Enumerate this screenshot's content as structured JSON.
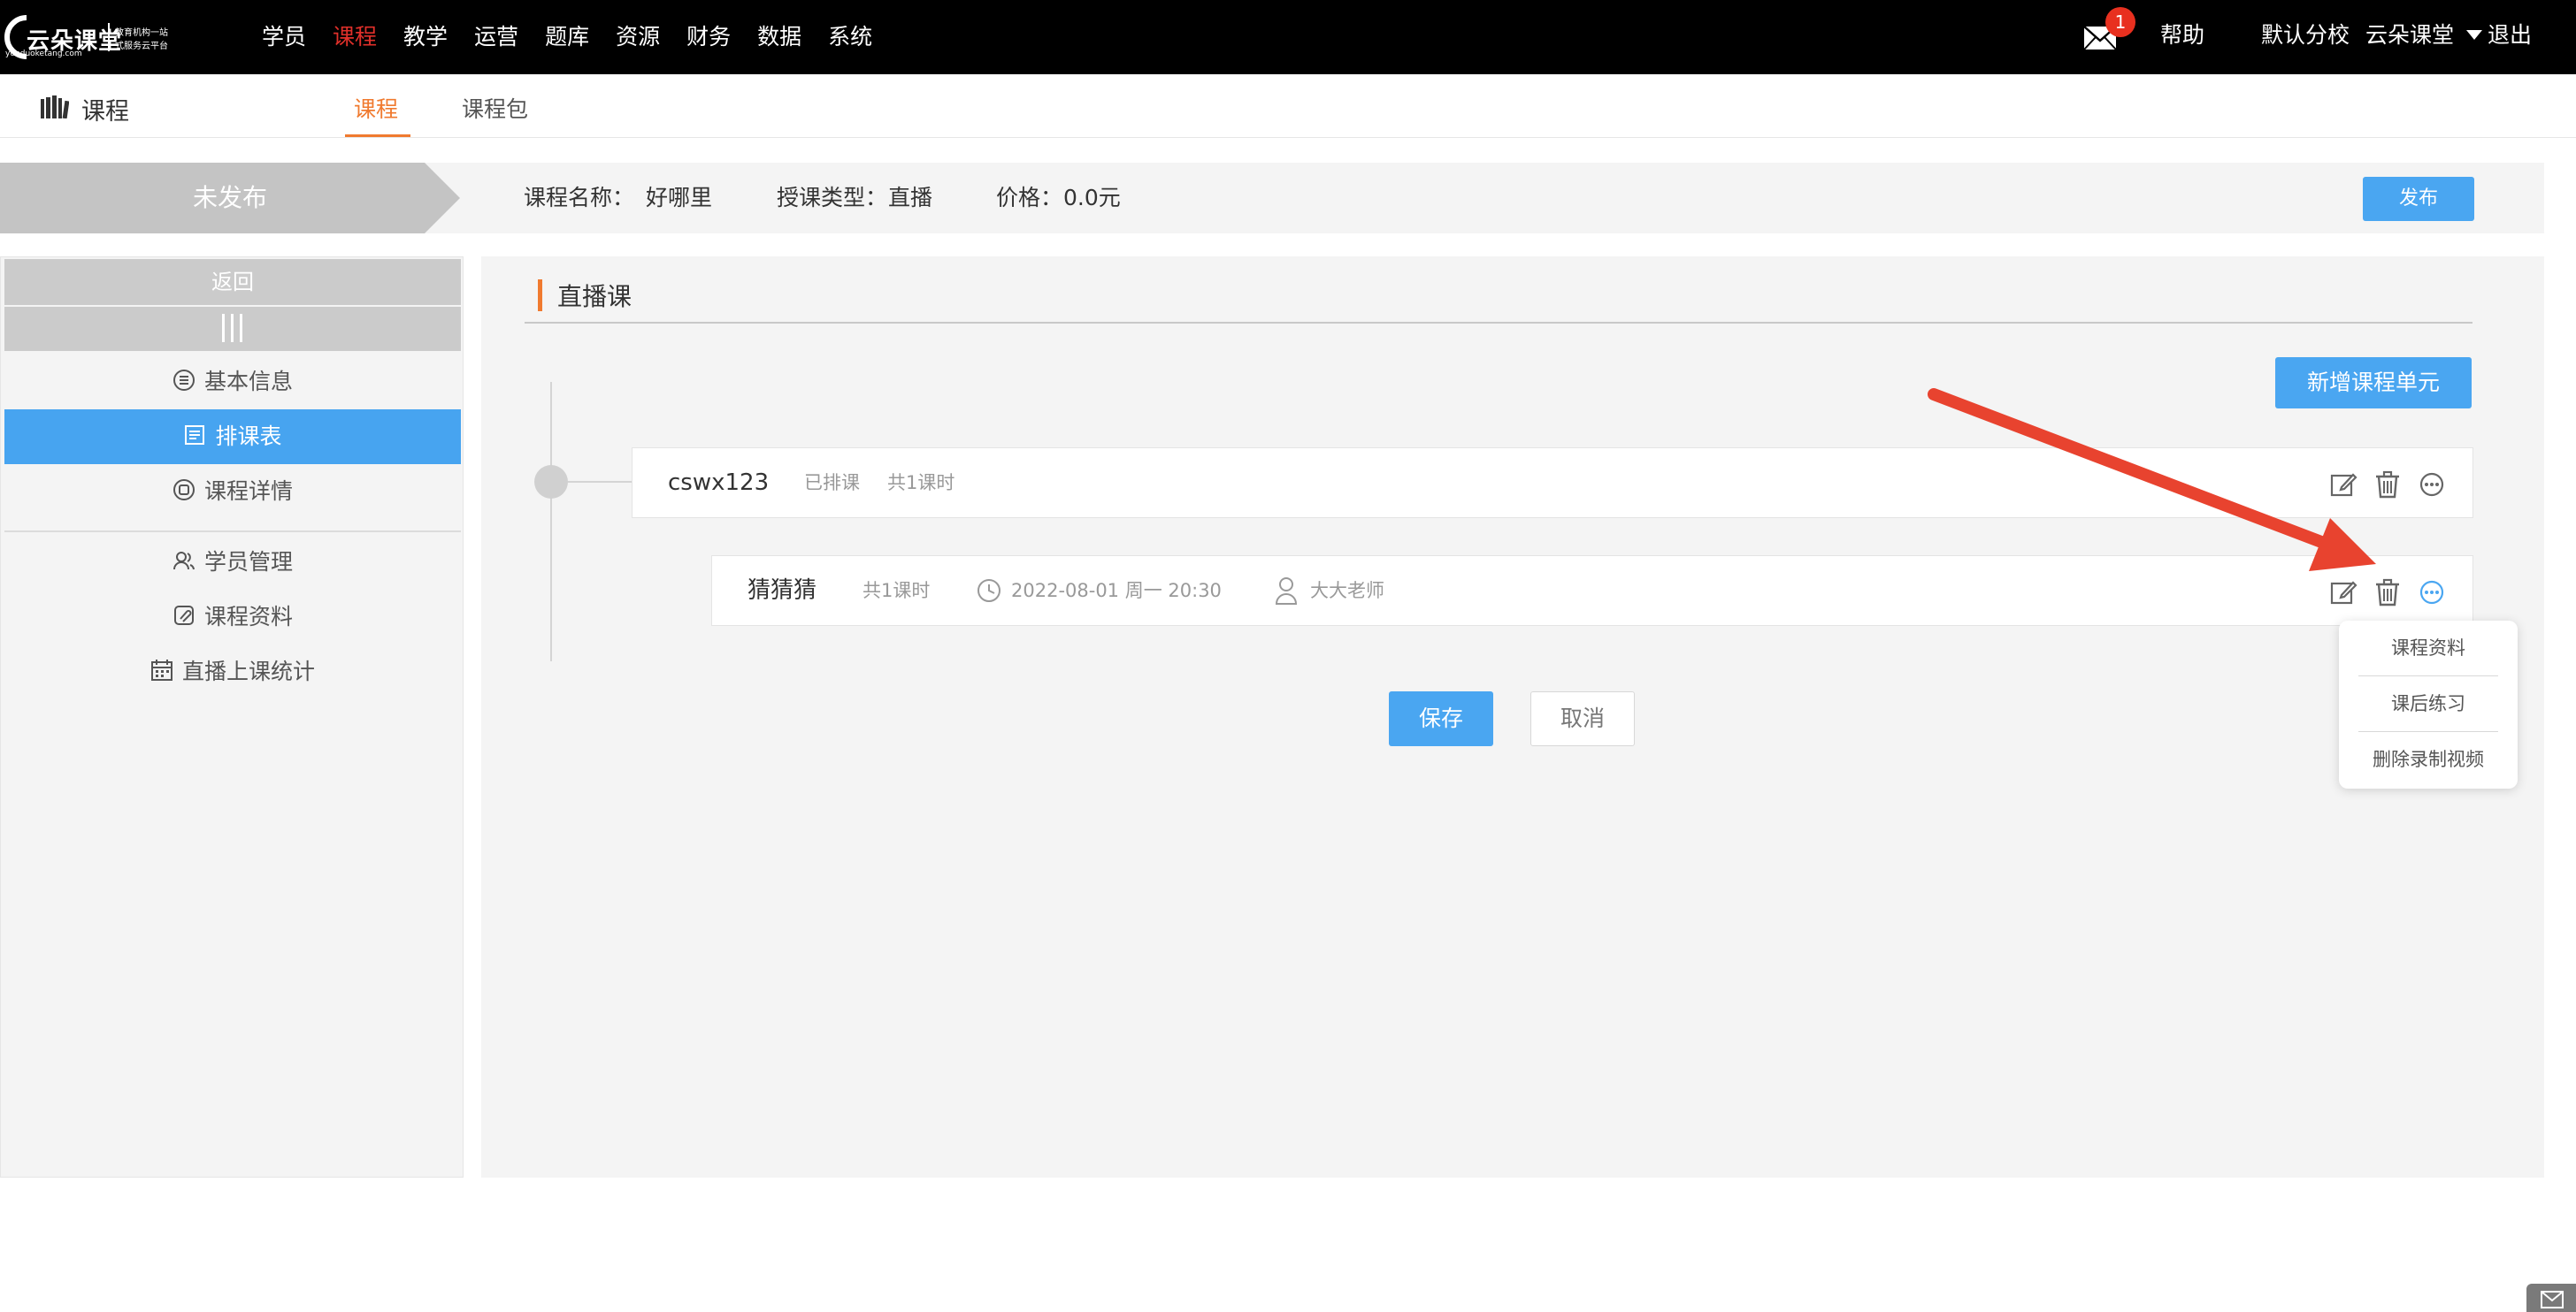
{
  "brand": {
    "name": "云朵课堂",
    "url": "yunduoketang.com",
    "tagline_line1": "教育机构一站",
    "tagline_line2": "式服务云平台"
  },
  "nav": {
    "items": [
      "学员",
      "课程",
      "教学",
      "运营",
      "题库",
      "资源",
      "财务",
      "数据",
      "系统"
    ],
    "active": "课程"
  },
  "header_right": {
    "mail_badge": "1",
    "help": "帮助",
    "branch": "默认分校",
    "account": "云朵课堂",
    "logout": "退出"
  },
  "subheader": {
    "title": "课程",
    "tabs": [
      "课程",
      "课程包"
    ],
    "active_tab": "课程"
  },
  "status_bar": {
    "status": "未发布",
    "course_name_label": "课程名称：",
    "course_name": "好哪里",
    "type_label": "授课类型：",
    "type": "直播",
    "price_label": "价格：",
    "price": "0.0元",
    "publish_button": "发布"
  },
  "sidebar": {
    "back": "返回",
    "items": [
      {
        "label": "基本信息",
        "icon": "list-circle-icon",
        "active": false
      },
      {
        "label": "排课表",
        "icon": "schedule-icon",
        "active": true
      },
      {
        "label": "课程详情",
        "icon": "detail-icon",
        "active": false
      },
      {
        "label": "学员管理",
        "icon": "users-icon",
        "active": false
      },
      {
        "label": "课程资料",
        "icon": "paperclip-icon",
        "active": false
      },
      {
        "label": "直播上课统计",
        "icon": "calendar-icon",
        "active": false
      }
    ]
  },
  "main": {
    "section_title": "直播课",
    "new_unit_button": "新增课程单元",
    "unit": {
      "name": "cswx123",
      "status": "已排课",
      "count": "共1课时"
    },
    "lesson": {
      "name": "猜猜猜",
      "count": "共1课时",
      "datetime": "2022-08-01 周一 20:30",
      "teacher": "大大老师"
    },
    "save_button": "保存",
    "cancel_button": "取消"
  },
  "dropdown": {
    "items": [
      "课程资料",
      "课后练习",
      "删除录制视频"
    ]
  },
  "colors": {
    "accent_blue": "#4aa6f1",
    "accent_orange": "#f07a2f",
    "nav_active_red": "#e0302a",
    "annotation_arrow": "#e8432f"
  }
}
